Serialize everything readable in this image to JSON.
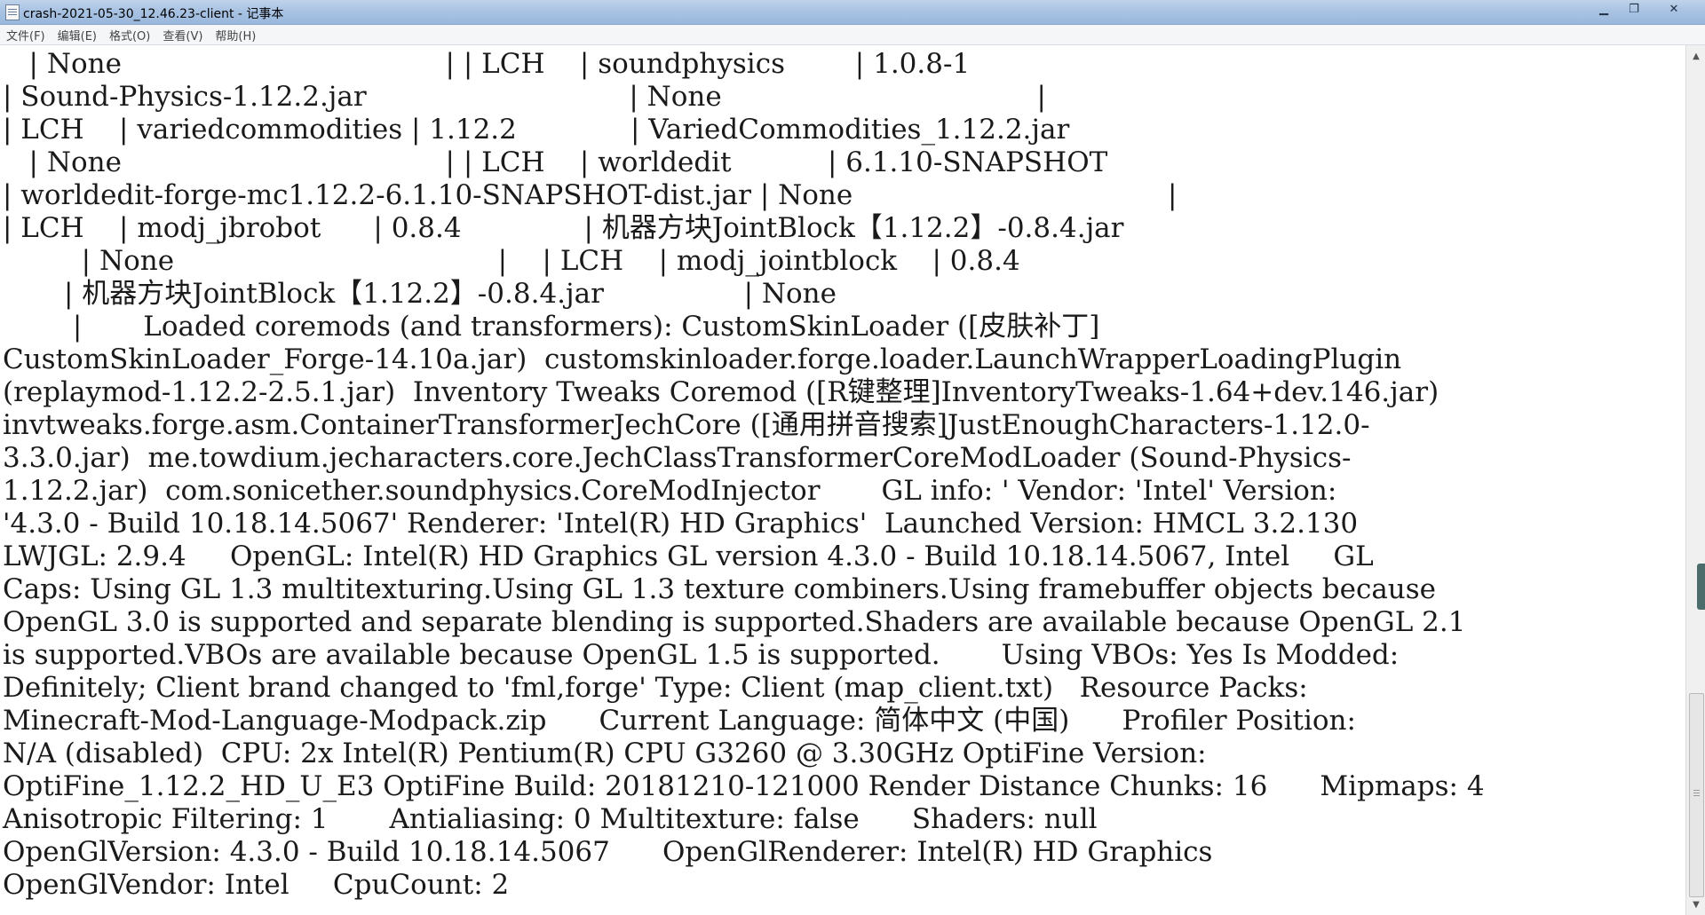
{
  "window": {
    "title": "crash-2021-05-30_12.46.23-client - 记事本",
    "controls": {
      "minimize": "▁",
      "maximize": "❐",
      "close": "✕"
    }
  },
  "menu": [
    {
      "label": "文件(F)"
    },
    {
      "label": "编辑(E)"
    },
    {
      "label": "格式(O)"
    },
    {
      "label": "查看(V)"
    },
    {
      "label": "帮助(H)"
    }
  ],
  "editor": {
    "lines": [
      "   | None                                     | | LCH    | soundphysics        | 1.0.8-1",
      "| Sound-Physics-1.12.2.jar                              | None                                    |",
      "| LCH    | variedcommodities | 1.12.2             | VariedCommodities_1.12.2.jar",
      "   | None                                     | | LCH    | worldedit           | 6.1.10-SNAPSHOT",
      "| worldedit-forge-mc1.12.2-6.1.10-SNAPSHOT-dist.jar | None                                    |",
      "| LCH    | modj_jbrobot      | 0.8.4              | 机器方块JointBlock【1.12.2】-0.8.4.jar",
      "         | None                                     |    | LCH    | modj_jointblock    | 0.8.4",
      "       | 机器方块JointBlock【1.12.2】-0.8.4.jar                | None",
      "        |       Loaded coremods (and transformers): CustomSkinLoader ([皮肤补丁]",
      "CustomSkinLoader_Forge-14.10a.jar)  customskinloader.forge.loader.LaunchWrapperLoadingPlugin",
      "(replaymod-1.12.2-2.5.1.jar)  Inventory Tweaks Coremod ([R键整理]InventoryTweaks-1.64+dev.146.jar)",
      "invtweaks.forge.asm.ContainerTransformerJechCore ([通用拼音搜索]JustEnoughCharacters-1.12.0-",
      "3.3.0.jar)  me.towdium.jecharacters.core.JechClassTransformerCoreModLoader (Sound-Physics-",
      "1.12.2.jar)  com.sonicether.soundphysics.CoreModInjector       GL info: ' Vendor: 'Intel' Version:",
      "'4.3.0 - Build 10.18.14.5067' Renderer: 'Intel(R) HD Graphics'  Launched Version: HMCL 3.2.130",
      "LWJGL: 2.9.4     OpenGL: Intel(R) HD Graphics GL version 4.3.0 - Build 10.18.14.5067, Intel     GL",
      "Caps: Using GL 1.3 multitexturing.Using GL 1.3 texture combiners.Using framebuffer objects because",
      "OpenGL 3.0 is supported and separate blending is supported.Shaders are available because OpenGL 2.1",
      "is supported.VBOs are available because OpenGL 1.5 is supported.       Using VBOs: Yes Is Modded:",
      "Definitely; Client brand changed to 'fml,forge' Type: Client (map_client.txt)   Resource Packs:",
      "Minecraft-Mod-Language-Modpack.zip      Current Language: 简体中文 (中国)      Profiler Position:",
      "N/A (disabled)  CPU: 2x Intel(R) Pentium(R) CPU G3260 @ 3.30GHz OptiFine Version:",
      "OptiFine_1.12.2_HD_U_E3 OptiFine Build: 20181210-121000 Render Distance Chunks: 16      Mipmaps: 4",
      "Anisotropic Filtering: 1       Antialiasing: 0 Multitexture: false      Shaders: null",
      "OpenGlVersion: 4.3.0 - Build 10.18.14.5067      OpenGlRenderer: Intel(R) HD Graphics",
      "OpenGlVendor: Intel     CpuCount: 2"
    ]
  },
  "icons": {
    "app": "notepad-icon",
    "scroll_up": "▲",
    "scroll_down": "▼"
  }
}
